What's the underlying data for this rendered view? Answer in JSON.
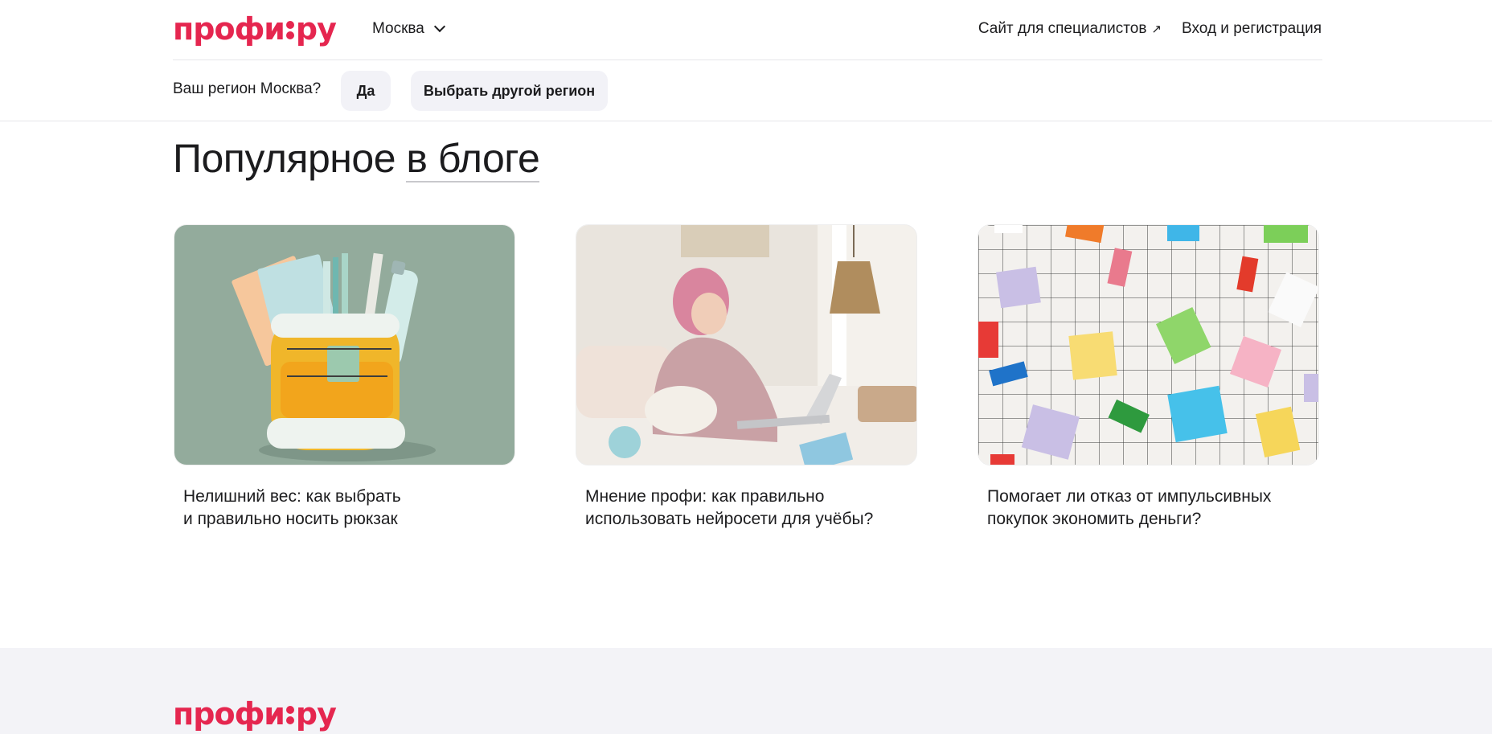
{
  "header": {
    "logo_left": "профи",
    "logo_right": "ру",
    "city": "Москва",
    "specialists_link": "Сайт для специалистов",
    "specialists_arrow": "↗",
    "login_link": "Вход и регистрация"
  },
  "region_banner": {
    "question": "Ваш регион Москва?",
    "yes_label": "Да",
    "other_label": "Выбрать другой регион"
  },
  "blog": {
    "title_prefix": "Популярное",
    "title_link": "в блоге",
    "cards": [
      {
        "caption": "Нелишний вес: как выбрать\nи правильно носить рюкзак"
      },
      {
        "caption": "Мнение профи: как правильно\nиспользовать нейросети для учёбы?"
      },
      {
        "caption": "Помогает ли отказ от импульсивных\nпокупок экономить деньги?"
      }
    ]
  },
  "footer": {
    "logo_left": "профи",
    "logo_right": "ру"
  },
  "colors": {
    "brand": "#e5264f",
    "button_bg": "#f2f2f7",
    "footer_bg": "#f3f3f7"
  }
}
